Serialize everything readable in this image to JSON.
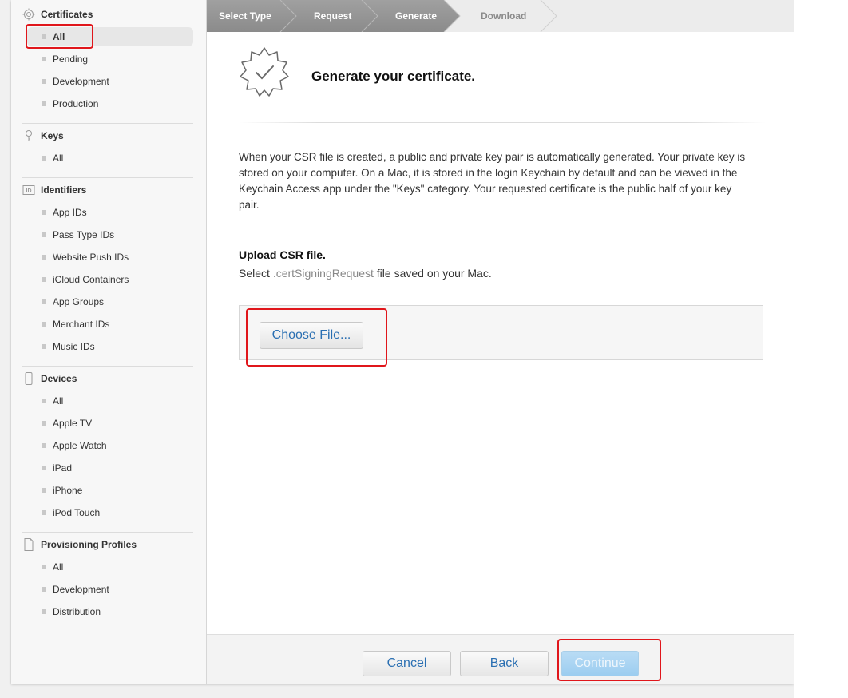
{
  "sidebar": {
    "sections": [
      {
        "title": "Certificates",
        "icon": "certificate-gear-icon",
        "items": [
          "All",
          "Pending",
          "Development",
          "Production"
        ]
      },
      {
        "title": "Keys",
        "icon": "key-icon",
        "items": [
          "All"
        ]
      },
      {
        "title": "Identifiers",
        "icon": "id-badge-icon",
        "items": [
          "App IDs",
          "Pass Type IDs",
          "Website Push IDs",
          "iCloud Containers",
          "App Groups",
          "Merchant IDs",
          "Music IDs"
        ]
      },
      {
        "title": "Devices",
        "icon": "device-icon",
        "items": [
          "All",
          "Apple TV",
          "Apple Watch",
          "iPad",
          "iPhone",
          "iPod Touch"
        ]
      },
      {
        "title": "Provisioning Profiles",
        "icon": "document-icon",
        "items": [
          "All",
          "Development",
          "Distribution"
        ]
      }
    ],
    "selected": "Certificates / All"
  },
  "steps": [
    "Select Type",
    "Request",
    "Generate",
    "Download"
  ],
  "current_step": "Generate",
  "content": {
    "title": "Generate your certificate.",
    "description": "When your CSR file is created, a public and private key pair is automatically generated. Your private key is stored on your computer. On a Mac, it is stored in the login Keychain by default and can be viewed in the Keychain Access app under the \"Keys\" category. Your requested certificate is the public half of your key pair.",
    "upload_title": "Upload CSR file.",
    "upload_prefix": "Select ",
    "upload_ext": ".certSigningRequest",
    "upload_suffix": " file saved on your Mac.",
    "choose_file_label": "Choose File..."
  },
  "footer": {
    "cancel": "Cancel",
    "back": "Back",
    "continue": "Continue"
  },
  "colors": {
    "accent": "#2a6fb2",
    "highlight": "#e0161b",
    "stepbar": "#959595"
  }
}
